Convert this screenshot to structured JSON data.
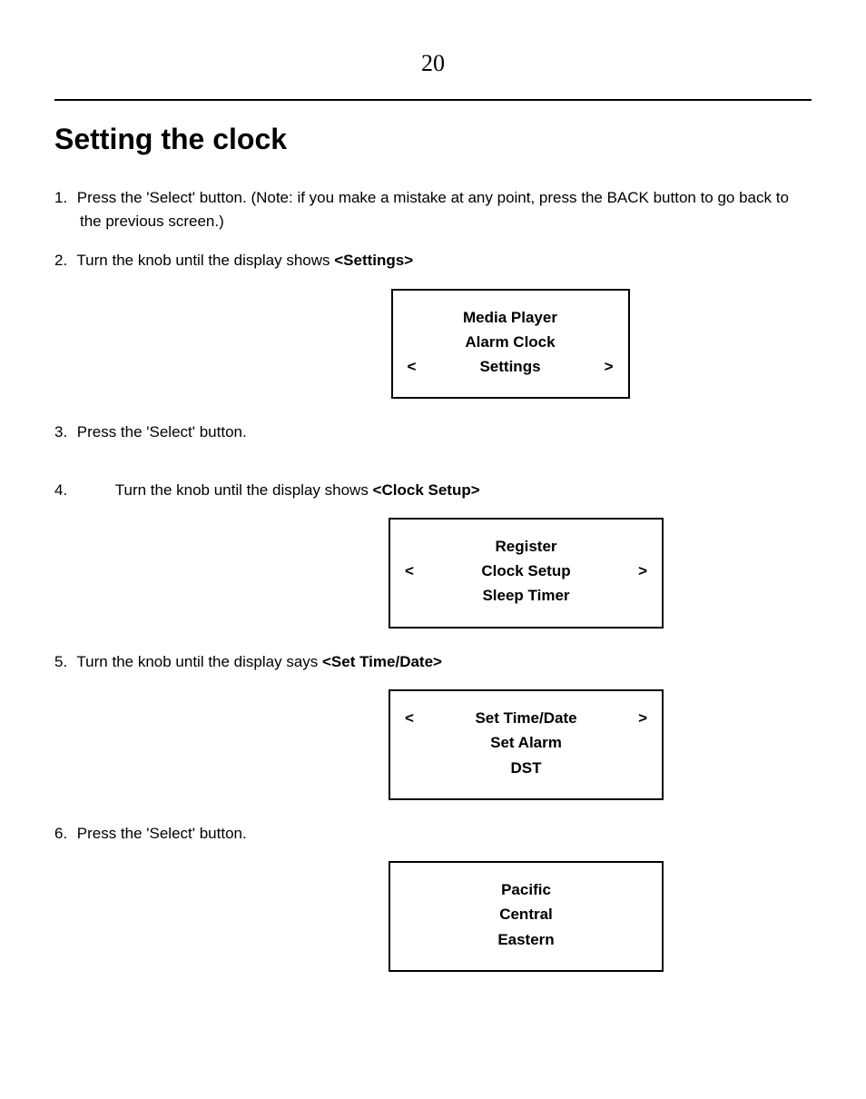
{
  "pageNumber": "20",
  "heading": "Setting the clock",
  "steps": {
    "s1": {
      "num": "1.",
      "text": "Press the 'Select' button. (Note: if you make a mistake at any point, press the BACK button to go back to the previous screen.)"
    },
    "s2": {
      "num": "2.",
      "prefix": "Turn the knob until the display shows ",
      "bold": "<Settings>"
    },
    "s3": {
      "num": "3.",
      "text": "Press the 'Select' button."
    },
    "s4": {
      "num": "4.",
      "prefix": "Turn the knob until the display shows ",
      "bold": "<Clock Setup>"
    },
    "s5": {
      "num": "5.",
      "prefix": "Turn the knob until the display says ",
      "bold": "<Set Time/Date>"
    },
    "s6": {
      "num": "6.",
      "text": "Press the 'Select' button."
    }
  },
  "arrows": {
    "left": "<",
    "right": ">"
  },
  "display1": {
    "r1": "Media Player",
    "r2": "Alarm Clock",
    "r3": "Settings"
  },
  "display2": {
    "r1": "Register",
    "r2": "Clock Setup",
    "r3": "Sleep Timer"
  },
  "display3": {
    "r1": "Set Time/Date",
    "r2": "Set Alarm",
    "r3": "DST"
  },
  "display4": {
    "r1": "Pacific",
    "r2": "Central",
    "r3": "Eastern"
  }
}
